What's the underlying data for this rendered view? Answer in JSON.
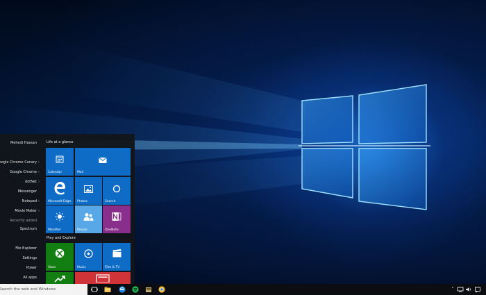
{
  "start_menu": {
    "user_name": "Mehedi Hassan",
    "left_items": [
      {
        "label": "Google Chrome Canary",
        "chevron": true
      },
      {
        "label": "Google Chrome",
        "chevron": true
      },
      {
        "label": "dotNet",
        "chevron": true
      },
      {
        "label": "Messenger",
        "chevron": false
      },
      {
        "label": "Notepad",
        "chevron": true
      },
      {
        "label": "Movie Maker",
        "chevron": true
      },
      {
        "label": "Recently added",
        "chevron": false
      },
      {
        "label": "Spectrum",
        "chevron": false
      },
      {
        "label": "File Explorer",
        "chevron": false
      },
      {
        "label": "Settings",
        "chevron": false
      },
      {
        "label": "Power",
        "chevron": false
      },
      {
        "label": "All apps",
        "chevron": false
      }
    ],
    "sections": {
      "life": "Life at a glance",
      "play": "Play and Explore"
    },
    "tiles": {
      "calendar": "Calendar",
      "mail": "Mail",
      "edge": "Microsoft Edge",
      "photos": "Photos",
      "search": "Search",
      "weather": "Weather",
      "people": "People",
      "onenote": "OneNote",
      "xbox": "Xbox",
      "music": "Music",
      "film": "Film & TV",
      "money": "",
      "news": ""
    }
  },
  "taskbar": {
    "search_placeholder": "Search the web and Windows",
    "apps": [
      "task-view-icon",
      "file-explorer-icon",
      "edge-icon",
      "spotify-icon",
      "media-app-icon",
      "chrome-canary-icon"
    ],
    "tray": [
      "show-hidden-icons",
      "network-icon",
      "volume-icon",
      "notifications-icon"
    ]
  },
  "colors": {
    "accent_blue": "#0f6cc6",
    "people_light_blue": "#58a7e6",
    "onenote_purple": "#8a2e8c",
    "xbox_green": "#127e11",
    "news_red": "#d13438",
    "start_bg": "#12161b",
    "taskbar_bg": "#0b0d10"
  }
}
